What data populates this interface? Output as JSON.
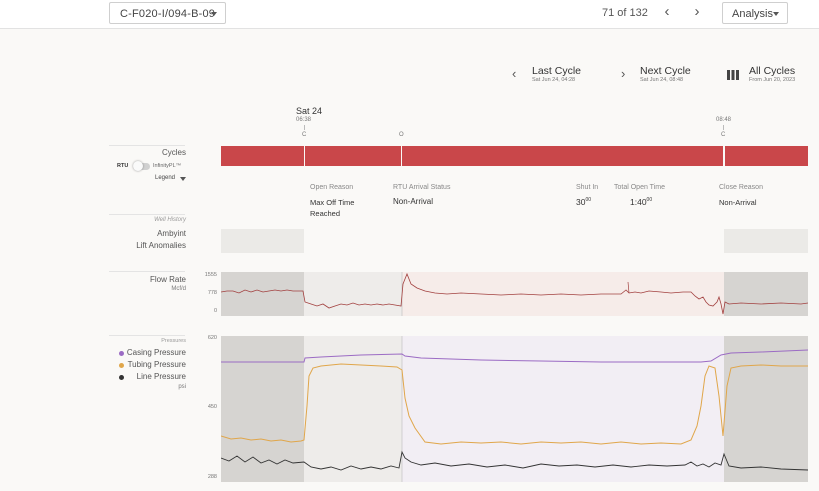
{
  "header": {
    "well_id": "C-F020-I/094-B-09",
    "pager": "71 of 132",
    "analysis_label": "Analysis"
  },
  "cycle_nav": {
    "last": {
      "title": "Last Cycle",
      "sub": "Sat Jun 24, 04:28"
    },
    "next": {
      "title": "Next Cycle",
      "sub": "Sat Jun 24, 08:48"
    },
    "all": {
      "title": "All Cycles",
      "sub": "From Jun 20, 2023"
    }
  },
  "timeline": {
    "date": "Sat 24",
    "start_time": "06:38",
    "end_time": "08:48",
    "marker_start": "C",
    "marker_open": "O",
    "marker_end": "C"
  },
  "cycles_panel": {
    "label": "Cycles",
    "toggle_left": "RTU",
    "toggle_right": "InfinityPL™",
    "legend_label": "Legend"
  },
  "cycle_info": {
    "open_reason_label": "Open Reason",
    "open_reason_line1": "Max Off Time",
    "open_reason_line2": "Reached",
    "rtu_label": "RTU Arrival Status",
    "rtu_value": "Non-Arrival",
    "shut_in_label": "Shut In",
    "shut_in_value": "30",
    "shut_in_sup": "00",
    "open_time_label": "Total Open Time",
    "open_time_value": "1:40",
    "open_time_sup": "00",
    "close_reason_label": "Close Reason",
    "close_reason_value": "Non-Arrival"
  },
  "well_history": {
    "heading": "Well History",
    "items": [
      "Ambyint",
      "Lift Anomalies"
    ]
  },
  "flow_rate": {
    "label": "Flow Rate",
    "unit": "Mcf/d",
    "ticks": [
      "1555",
      "778",
      "0"
    ]
  },
  "pressures": {
    "heading": "Pressures",
    "unit": "psi",
    "ticks": [
      "620",
      "450",
      "288"
    ],
    "series": [
      {
        "name": "Casing Pressure",
        "color": "#9b6bc4"
      },
      {
        "name": "Tubing Pressure",
        "color": "#e0a64a"
      },
      {
        "name": "Line Pressure",
        "color": "#333333"
      }
    ]
  },
  "colors": {
    "cycle_bar": "#c9474a",
    "flow_line": "#a2403f"
  }
}
